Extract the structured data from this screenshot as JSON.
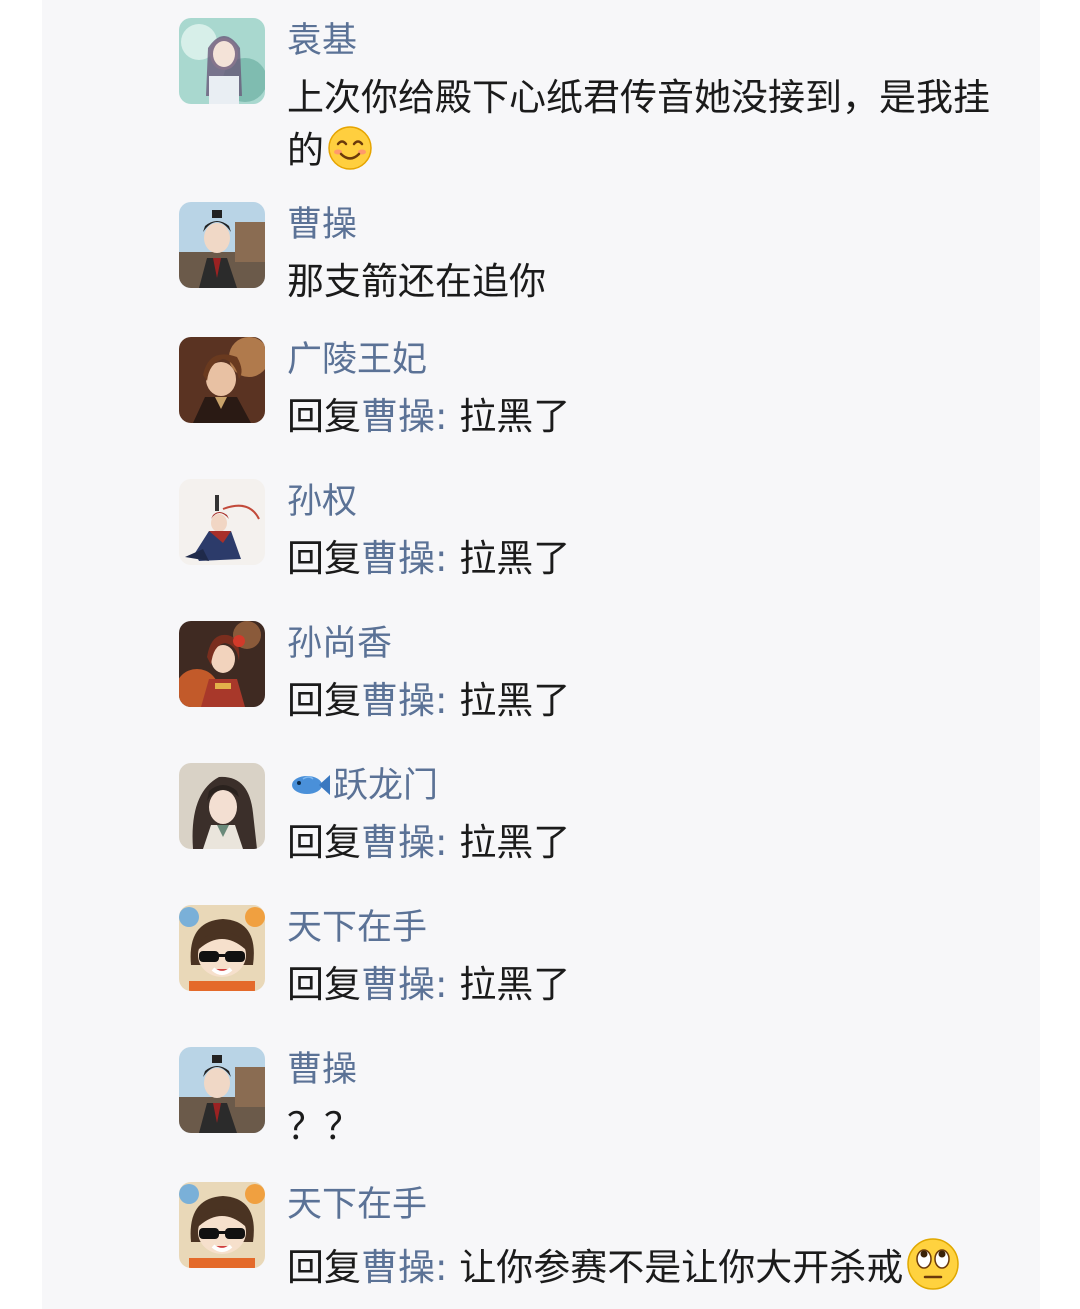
{
  "messages": [
    {
      "sender": "袁基",
      "avatar": "avatar-yuanji",
      "text": "上次你给殿下心纸君传音她没接到，是我挂的",
      "emoji": "smiling-face-icon"
    },
    {
      "sender": "曹操",
      "avatar": "avatar-caocao",
      "text": "那支箭还在追你"
    },
    {
      "sender": "广陵王妃",
      "avatar": "avatar-guangling",
      "reply_prefix": "回复",
      "reply_to": "曹操:",
      "text": "拉黑了"
    },
    {
      "sender": "孙权",
      "avatar": "avatar-sunquan",
      "reply_prefix": "回复",
      "reply_to": "曹操:",
      "text": "拉黑了"
    },
    {
      "sender": "孙尚香",
      "avatar": "avatar-sunshangxiang",
      "reply_prefix": "回复",
      "reply_to": "曹操:",
      "text": "拉黑了"
    },
    {
      "sender": "跃龙门",
      "sender_icon": "fish-icon",
      "avatar": "avatar-yuelongmen",
      "reply_prefix": "回复",
      "reply_to": "曹操:",
      "text": "拉黑了"
    },
    {
      "sender": "天下在手",
      "avatar": "avatar-tianxia",
      "reply_prefix": "回复",
      "reply_to": "曹操:",
      "text": "拉黑了"
    },
    {
      "sender": "曹操",
      "avatar": "avatar-caocao",
      "text": "？？"
    },
    {
      "sender": "天下在手",
      "avatar": "avatar-tianxia",
      "reply_prefix": "回复",
      "reply_to": "曹操:",
      "text": "让你参赛不是让你大开杀戒",
      "emoji": "rolling-eyes-face-icon"
    }
  ],
  "colors": {
    "name": "#5b7296",
    "text": "#1b1b1b",
    "panel": "#f7f7f9"
  }
}
